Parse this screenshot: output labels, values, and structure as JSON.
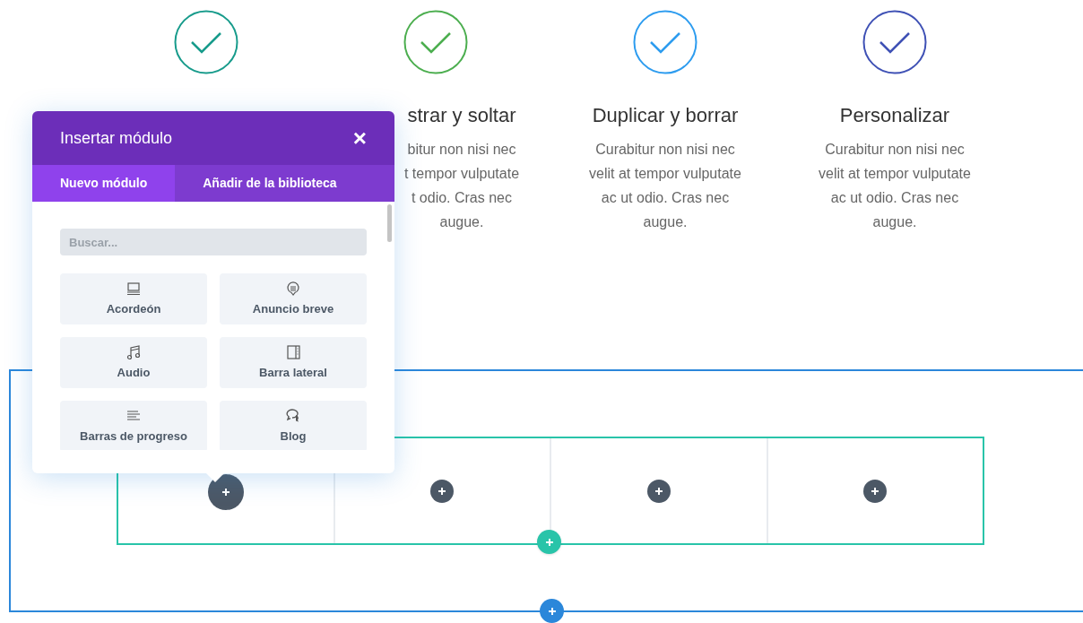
{
  "features": [
    {
      "color": "#179b8b"
    },
    {
      "color": "#4cae4f",
      "title": "strar y soltar",
      "description": [
        "bitur non nisi nec",
        "t tempor vulputate",
        "t odio. Cras nec",
        "augue."
      ]
    },
    {
      "color": "#2d9cef",
      "title": "Duplicar y borrar",
      "description": [
        "Curabitur non nisi nec",
        "velit at tempor vulputate",
        "ac ut odio. Cras nec",
        "augue."
      ]
    },
    {
      "color": "#3f51b5",
      "title": "Personalizar",
      "description": [
        "Curabitur non nisi nec",
        "velit at tempor vulputate",
        "ac ut odio. Cras nec",
        "augue."
      ]
    }
  ],
  "row": {
    "columns": [
      {
        "active": true
      },
      {
        "active": false
      },
      {
        "active": false
      },
      {
        "active": false
      }
    ]
  },
  "modal": {
    "title": "Insertar módulo",
    "close": "×",
    "tabs": [
      {
        "label": "Nuevo módulo",
        "selected": true
      },
      {
        "label": "Añadir de la biblioteca",
        "selected": false
      }
    ],
    "search": {
      "placeholder": "Buscar..."
    },
    "modules": [
      {
        "kind": "accordion",
        "label": "Acordeón"
      },
      {
        "kind": "notice",
        "label": "Anuncio breve"
      },
      {
        "kind": "audio",
        "label": "Audio"
      },
      {
        "kind": "sidebar",
        "label": "Barra lateral"
      },
      {
        "kind": "bars",
        "label": "Barras de progreso"
      },
      {
        "kind": "blog",
        "label": "Blog"
      }
    ]
  }
}
